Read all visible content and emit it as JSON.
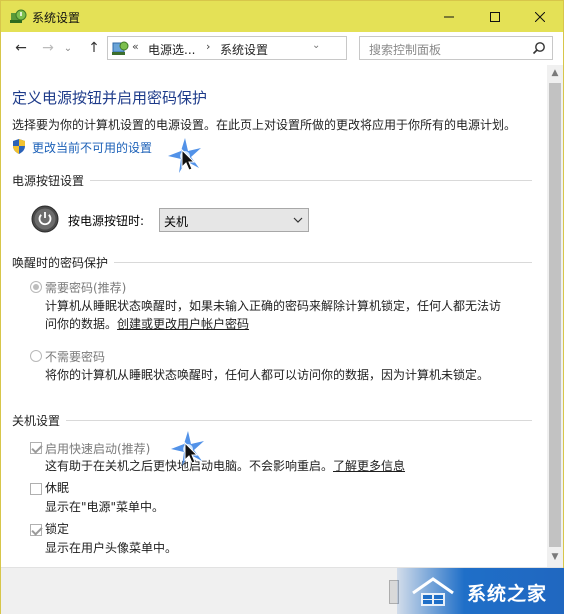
{
  "window": {
    "title": "系统设置"
  },
  "nav": {
    "back": "←",
    "forward": "→",
    "dropdown": "⌄",
    "up": "↑",
    "breadcrumb_prefix": "«",
    "breadcrumb": [
      "电源选...",
      "系统设置"
    ],
    "breadcrumb_sep": "›",
    "search_placeholder": "搜索控制面板"
  },
  "page": {
    "title": "定义电源按钮并启用密码保护",
    "description": "选择要为你的计算机设置的电源设置。在此页上对设置所做的更改将应用于你所有的电源计划。",
    "change_link": "更改当前不可用的设置"
  },
  "power_button": {
    "section": "电源按钮设置",
    "label": "按电源按钮时:",
    "value": "关机"
  },
  "password": {
    "section": "唤醒时的密码保护",
    "require_label": "需要密码(推荐)",
    "require_desc_1": "计算机从睡眠状态唤醒时，如果未输入正确的密码来解除计算机锁定，任何人都无法访",
    "require_desc_2": "问你的数据。",
    "require_link": "创建或更改用户帐户密码",
    "norequire_label": "不需要密码",
    "norequire_desc": "将你的计算机从睡眠状态唤醒时，任何人都可以访问你的数据，因为计算机未锁定。"
  },
  "shutdown": {
    "section": "关机设置",
    "fast_label": "启用快速启动(推荐)",
    "fast_desc": "这有助于在关机之后更快地启动电脑。不会影响重启。",
    "fast_link": "了解更多信息",
    "hibernate_label": "休眠",
    "hibernate_desc": "显示在\"电源\"菜单中。",
    "lock_label": "锁定",
    "lock_desc": "显示在用户头像菜单中。"
  },
  "watermark": {
    "text": "系统之家"
  },
  "colors": {
    "titlebar": "#e4e156",
    "link": "#1c61b8",
    "heading": "#1e3b8a"
  }
}
